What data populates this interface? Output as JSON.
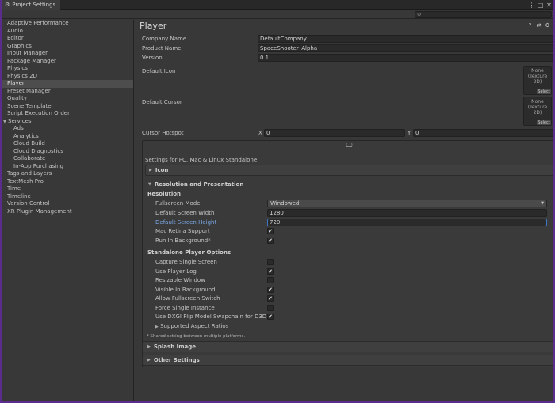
{
  "window": {
    "title": "Project Settings",
    "search_placeholder": ""
  },
  "icons": {
    "window": "gear-icon",
    "more": "kebab-menu-icon",
    "maximize": "maximize-icon",
    "close": "close-icon",
    "search": "search-icon",
    "help": "help-icon",
    "preset": "preset-icon",
    "settings": "gear-icon",
    "monitor": "monitor-icon"
  },
  "sidebar": {
    "items": [
      "Adaptive Performance",
      "Audio",
      "Editor",
      "Graphics",
      "Input Manager",
      "Package Manager",
      "Physics",
      "Physics 2D",
      "Player",
      "Preset Manager",
      "Quality",
      "Scene Template",
      "Script Execution Order",
      "Services"
    ],
    "services_children": [
      "Ads",
      "Analytics",
      "Cloud Build",
      "Cloud Diagnostics",
      "Collaborate",
      "In-App Purchasing"
    ],
    "items_after": [
      "Tags and Layers",
      "TextMesh Pro",
      "Time",
      "Timeline",
      "Version Control",
      "XR Plugin Management"
    ],
    "selected": "Player"
  },
  "player": {
    "title": "Player",
    "company_label": "Company Name",
    "company_value": "DefaultCompany",
    "product_label": "Product Name",
    "product_value": "SpaceShooter_Alpha",
    "version_label": "Version",
    "version_value": "0.1",
    "default_icon_label": "Default Icon",
    "default_cursor_label": "Default Cursor",
    "texture_none": "None",
    "texture_type": "(Texture 2D)",
    "texture_select": "Select",
    "hotspot_label": "Cursor Hotspot",
    "hotspot_x_label": "X",
    "hotspot_x": "0",
    "hotspot_y_label": "Y",
    "hotspot_y": "0"
  },
  "platform": {
    "settings_title": "Settings for PC, Mac & Linux Standalone",
    "icon_section": "Icon",
    "resolution_section": "Resolution and Presentation",
    "resolution_sub": "Resolution",
    "fullscreen_label": "Fullscreen Mode",
    "fullscreen_value": "Windowed",
    "width_label": "Default Screen Width",
    "width_value": "1280",
    "height_label": "Default Screen Height",
    "height_value": "720",
    "retina_label": "Mac Retina Support",
    "retina_checked": true,
    "runbg_label": "Run In Background*",
    "runbg_checked": true,
    "standalone_sub": "Standalone Player Options",
    "options": [
      {
        "label": "Capture Single Screen",
        "checked": false
      },
      {
        "label": "Use Player Log",
        "checked": true
      },
      {
        "label": "Resizable Window",
        "checked": false
      },
      {
        "label": "Visible In Background",
        "checked": true
      },
      {
        "label": "Allow Fullscreen Switch",
        "checked": true
      },
      {
        "label": "Force Single Instance",
        "checked": false
      },
      {
        "label": "Use DXGI Flip Model Swapchain for D3D11",
        "checked": true
      }
    ],
    "aspect_label": "Supported Aspect Ratios",
    "note": "* Shared setting between multiple platforms.",
    "splash_section": "Splash Image",
    "other_section": "Other Settings",
    "check_glyph": "✔"
  }
}
